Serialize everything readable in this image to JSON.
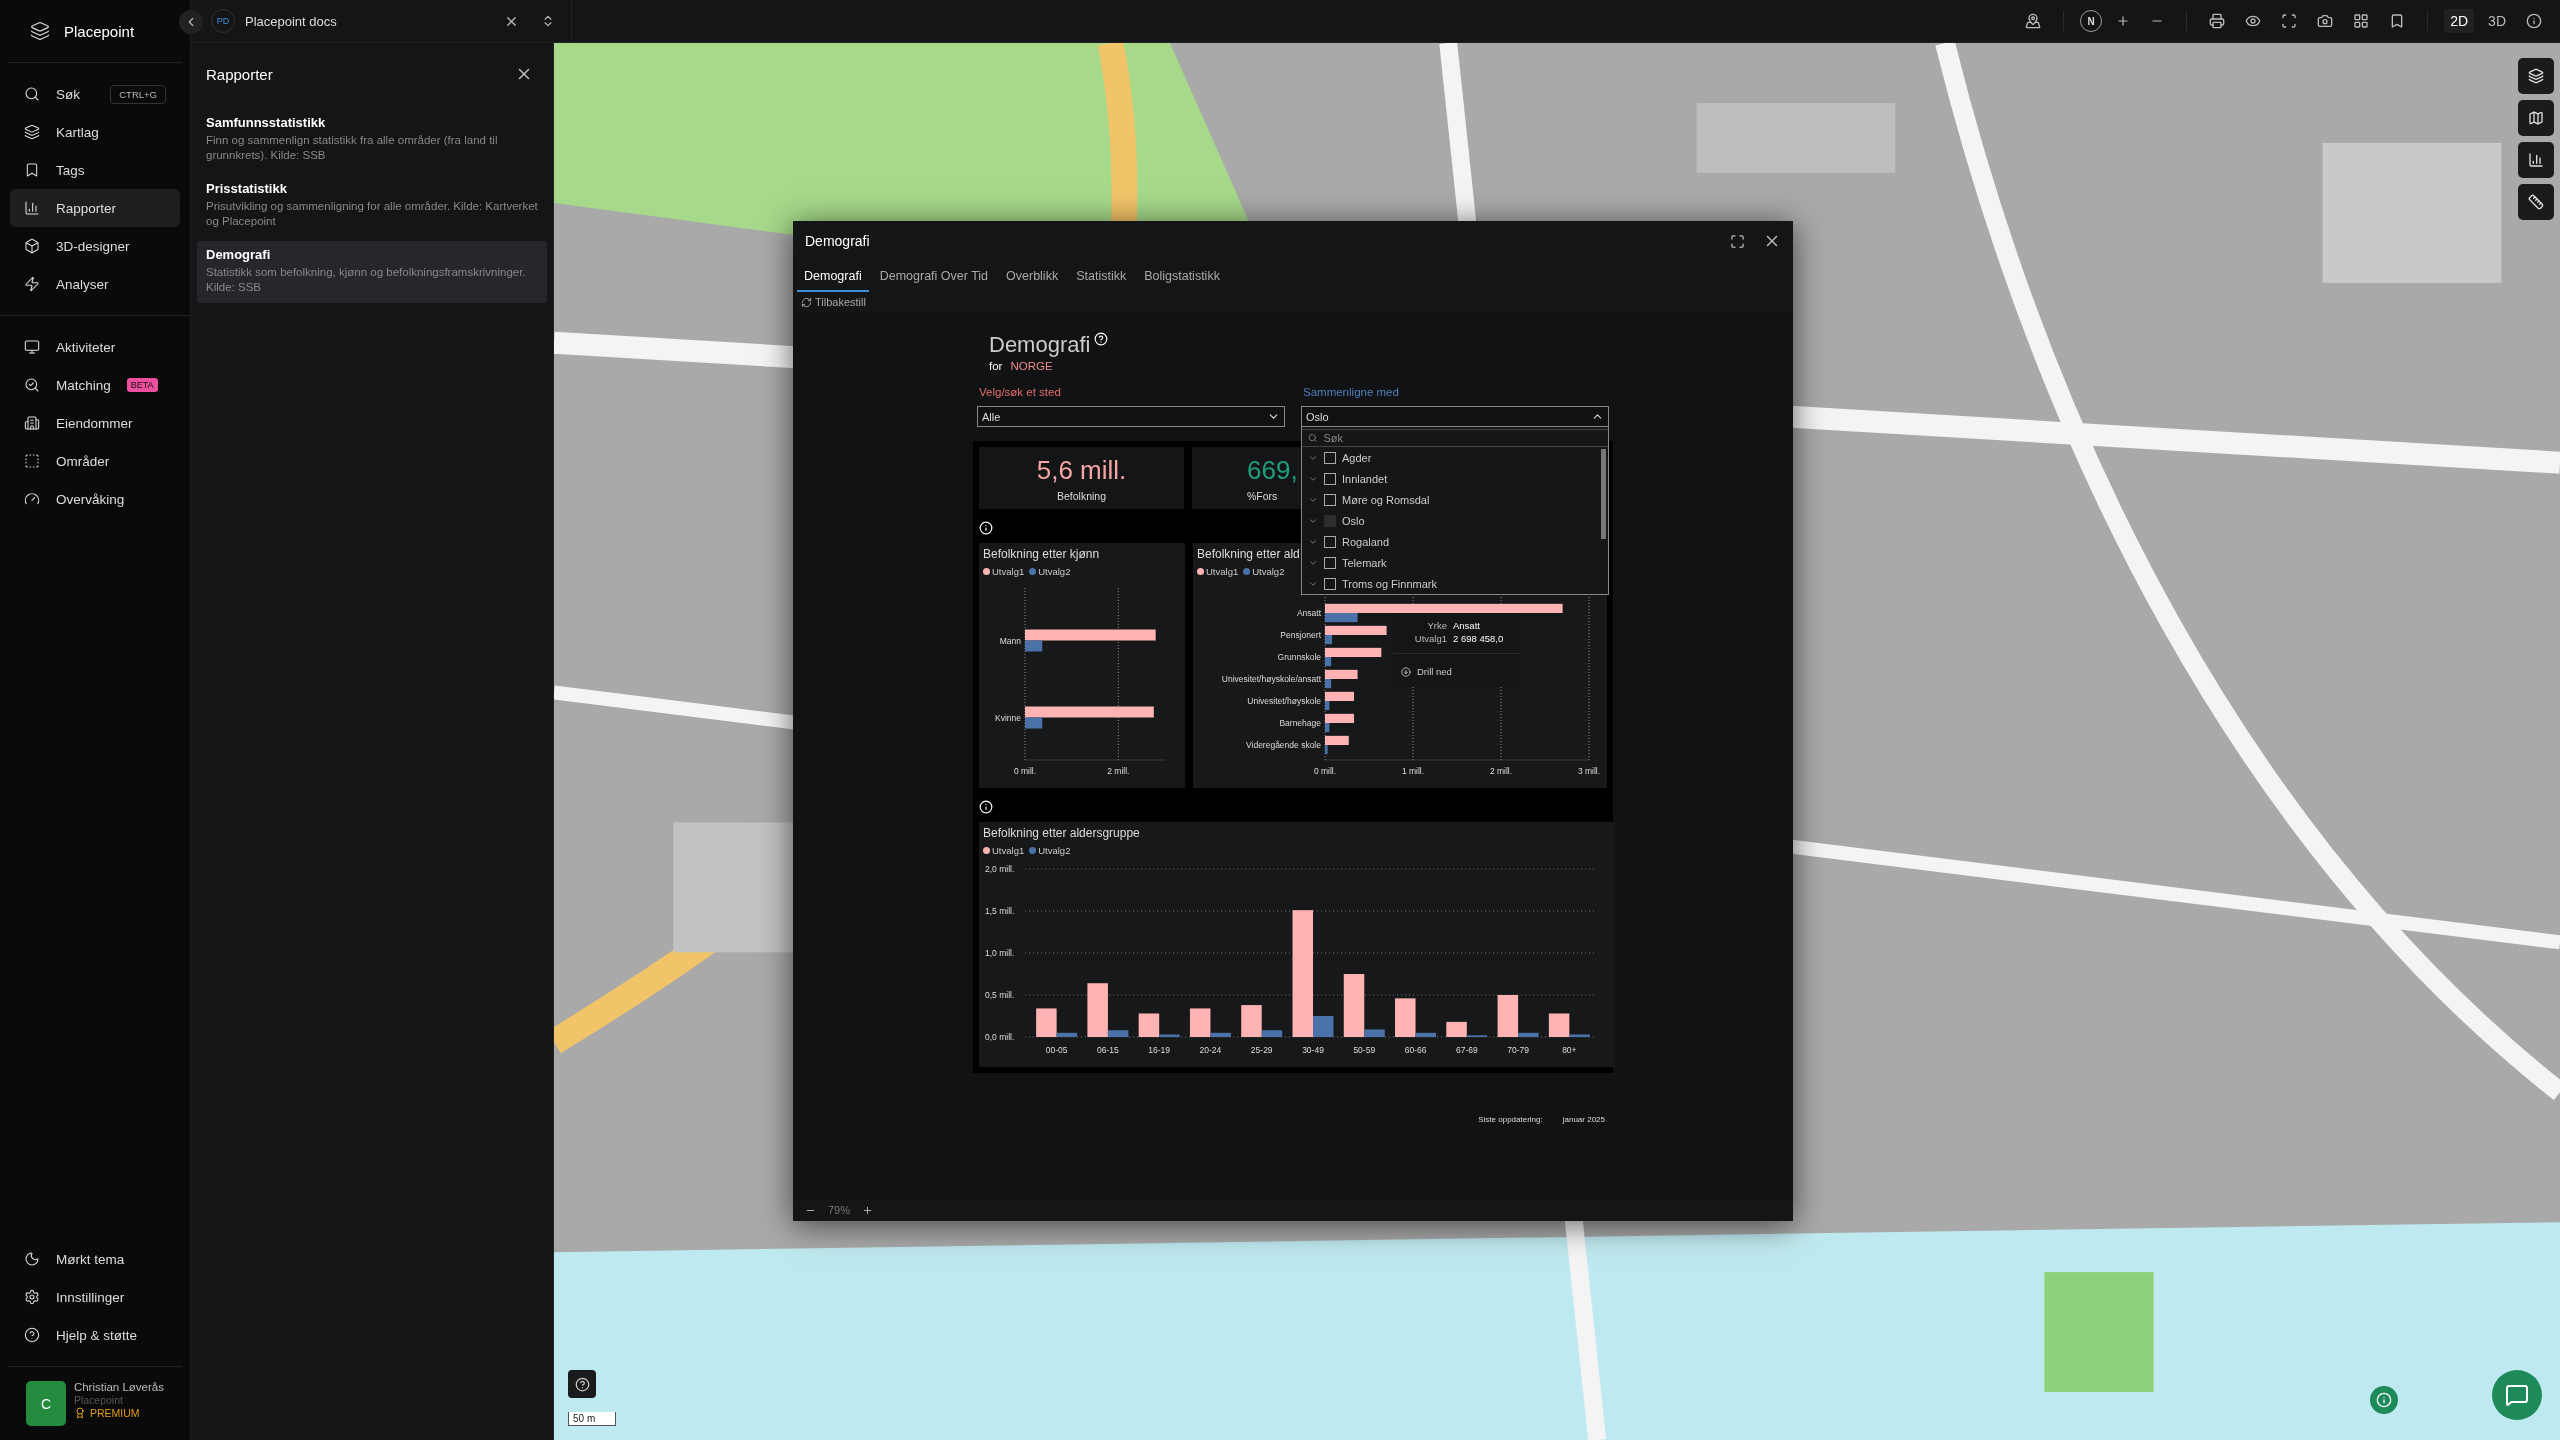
{
  "app": {
    "name": "Placepoint"
  },
  "nav_main": [
    {
      "label": "Søk",
      "shortcut": "CTRL+G",
      "selected": false
    },
    {
      "label": "Kartlag",
      "selected": false
    },
    {
      "label": "Tags",
      "selected": false
    },
    {
      "label": "Rapporter",
      "selected": true
    },
    {
      "label": "3D-designer",
      "selected": false
    },
    {
      "label": "Analyser",
      "selected": false
    }
  ],
  "nav_secondary": [
    {
      "label": "Aktiviteter",
      "selected": false
    },
    {
      "label": "Matching",
      "badge": "BETA",
      "selected": false
    },
    {
      "label": "Eiendommer",
      "selected": false
    },
    {
      "label": "Områder",
      "selected": false
    },
    {
      "label": "Overvåking",
      "selected": false
    }
  ],
  "nav_bottom": [
    {
      "label": "Mørkt tema"
    },
    {
      "label": "Innstillinger"
    },
    {
      "label": "Hjelp & støtte"
    }
  ],
  "user": {
    "initial": "C",
    "name": "Christian Løverås",
    "org": "Placepoint",
    "plan": "PREMIUM"
  },
  "workspace": {
    "initials": "PD",
    "name": "Placepoint docs"
  },
  "reports_panel": {
    "title": "Rapporter",
    "items": [
      {
        "title": "Samfunnsstatistikk",
        "description": "Finn og sammenlign statistikk fra alle områder (fra land til grunnkrets). Kilde: SSB",
        "selected": false
      },
      {
        "title": "Prisstatistikk",
        "description": "Prisutvikling og sammenligning for alle områder. Kilde: Kartverket og Placepoint",
        "selected": false
      },
      {
        "title": "Demografi",
        "description": "Statistikk som befolkning, kjønn og befolkningsframskrivninger. Kilde: SSB",
        "selected": true
      }
    ]
  },
  "map_toolbar": {
    "compass": "N",
    "view_modes": [
      {
        "label": "2D",
        "selected": true
      },
      {
        "label": "3D",
        "selected": false
      }
    ]
  },
  "map": {
    "scale": "50 m"
  },
  "dialog": {
    "title": "Demografi",
    "tabs": [
      {
        "label": "Demografi",
        "selected": true
      },
      {
        "label": "Demografi Over Tid",
        "selected": false
      },
      {
        "label": "Overblikk",
        "selected": false
      },
      {
        "label": "Statistikk",
        "selected": false
      },
      {
        "label": "Boligstatistikk",
        "selected": false
      }
    ],
    "reset": "Tilbakestill",
    "zoom": "79%",
    "report": {
      "title": "Demografi",
      "for_label": "for",
      "place": "NORGE",
      "select_label": "Velg/søk et sted",
      "select_value": "Alle",
      "compare_label": "Sammenligne med",
      "compare_value": "Oslo",
      "compare_open": true,
      "dropdown": {
        "placeholder": "Søk",
        "options": [
          {
            "label": "Agder",
            "selected": false
          },
          {
            "label": "Innlandet",
            "selected": false
          },
          {
            "label": "Møre og Romsdal",
            "selected": false
          },
          {
            "label": "Oslo",
            "selected": true
          },
          {
            "label": "Rogaland",
            "selected": false
          },
          {
            "label": "Telemark",
            "selected": false
          },
          {
            "label": "Troms og Finnmark",
            "selected": false
          }
        ]
      },
      "kpis": [
        {
          "value": "5,6 mill.",
          "label": "Befolkning",
          "color": "#f7a5a5"
        },
        {
          "value": "669,",
          "label": "%Fors",
          "color": "#1e9e7c"
        }
      ],
      "sex_chart": {
        "chart_data": {
          "type": "bar",
          "orientation": "horizontal",
          "title": "Befolkning etter kjønn",
          "categories": [
            "Mann",
            "Kvinne"
          ],
          "series": [
            {
              "name": "Utvalg1",
              "color": "#ffb3b3",
              "values": [
                2.8,
                2.76
              ]
            },
            {
              "name": "Utvalg2",
              "color": "#4a72a8",
              "values": [
                0.37,
                0.37
              ]
            }
          ],
          "grid": true,
          "xlim": [
            0,
            3
          ],
          "xticks": [
            {
              "value": 0,
              "label": "0 mill."
            },
            {
              "value": 2,
              "label": "2 mill."
            }
          ]
        }
      },
      "occupation_chart": {
        "chart_data": {
          "type": "bar",
          "orientation": "horizontal",
          "title": "Befolkning etter ald",
          "categories": [
            "Ansatt",
            "Pensjonert",
            "Grunnskole",
            "Univesitet/høyskole/ansatt",
            "Univesitet/høyskole",
            "Barnehage",
            "Videregående skole"
          ],
          "series": [
            {
              "name": "Utvalg1",
              "color": "#ffb3b3",
              "values": [
                2.7,
                0.7,
                0.64,
                0.37,
                0.33,
                0.33,
                0.27
              ]
            },
            {
              "name": "Utvalg2",
              "color": "#4a72a8",
              "values": [
                0.37,
                0.08,
                0.07,
                0.07,
                0.05,
                0.05,
                0.03
              ]
            }
          ],
          "grid": true,
          "xlim": [
            0,
            3
          ],
          "xticks": [
            {
              "value": 0,
              "label": "0 mill."
            },
            {
              "value": 1,
              "label": "1 mill."
            },
            {
              "value": 2,
              "label": "2 mill."
            },
            {
              "value": 3,
              "label": "3 mill."
            }
          ]
        },
        "tooltip": {
          "rows": [
            {
              "key": "Yrke",
              "value": "Ansatt"
            },
            {
              "key": "Utvalg1",
              "value": "2 698 458,0"
            }
          ],
          "action": "Drill ned"
        }
      },
      "age_chart": {
        "chart_data": {
          "type": "bar",
          "title": "Befolkning etter aldersgruppe",
          "categories": [
            "00-05",
            "06-15",
            "16-19",
            "20-24",
            "25-29",
            "30-49",
            "50-59",
            "60-66",
            "67-69",
            "70-79",
            "80+"
          ],
          "series": [
            {
              "name": "Utvalg1",
              "color": "#ffb3b3",
              "values": [
                0.34,
                0.64,
                0.28,
                0.34,
                0.38,
                1.51,
                0.75,
                0.46,
                0.18,
                0.5,
                0.28
              ]
            },
            {
              "name": "Utvalg2",
              "color": "#4a72a8",
              "values": [
                0.05,
                0.08,
                0.03,
                0.05,
                0.08,
                0.25,
                0.09,
                0.05,
                0.02,
                0.05,
                0.03
              ]
            }
          ],
          "grid": true,
          "ylim": [
            0,
            2
          ],
          "yticks": [
            {
              "value": 0,
              "label": "0,0 mill."
            },
            {
              "value": 0.5,
              "label": "0,5 mill."
            },
            {
              "value": 1,
              "label": "1,0 mill."
            },
            {
              "value": 1.5,
              "label": "1,5 mill."
            },
            {
              "value": 2,
              "label": "2,0 mill."
            }
          ]
        }
      },
      "update_label": "Siste oppdatering:",
      "update_value": "januar 2025"
    }
  }
}
